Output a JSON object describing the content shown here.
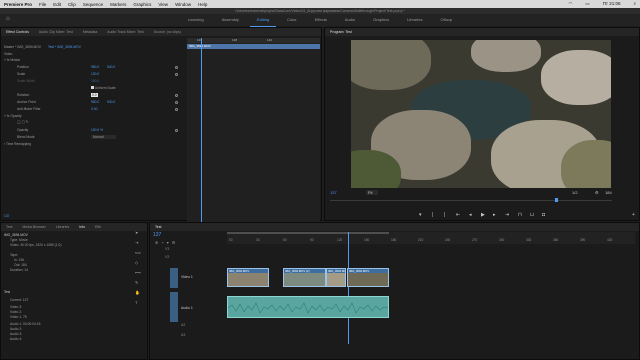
{
  "menubar": {
    "app": "Premiere Pro",
    "items": [
      "File",
      "Edit",
      "Clip",
      "Sequence",
      "Markers",
      "Graphics",
      "View",
      "Window",
      "Help"
    ],
    "clock": "Пт 21:06"
  },
  "title": "/Volumes/external/project/DataCore/Video/04_Агрусова мариамия/Camera/Walkthrough/Project/Test.prproj *",
  "workspaces": [
    "Learning",
    "Assembly",
    "Editing",
    "Color",
    "Effects",
    "Audio",
    "Graphics",
    "Libraries",
    "Обзор"
  ],
  "active_workspace": "Editing",
  "source_tabs": [
    "Effect Controls",
    "Audio Clip Mixer: Test",
    "Metadata",
    "Audio Track Mixer: Test",
    "Source: (no clips)"
  ],
  "effect_controls": {
    "clip_path": "Master * IMG_3694.MOV",
    "seq_path": "Test * IMG_3694.MOV",
    "ruler": [
      "136",
      "138",
      "140"
    ],
    "mini_clip": "IMG_3694.MOV",
    "section_video": "Video",
    "motion": "Motion",
    "position_label": "Position",
    "position_x": "960.0",
    "position_y": "540.0",
    "scale_label": "Scale",
    "scale_value": "100.0",
    "scale_width_label": "Scale Width",
    "scale_width_value": "100.0",
    "uniform_label": "Uniform Scale",
    "rotation_label": "Rotation",
    "rotation_value": "0.0",
    "anchor_label": "Anchor Point",
    "anchor_x": "960.0",
    "anchor_y": "540.0",
    "antiflicker_label": "Anti-flicker Filter",
    "antiflicker_value": "0.00",
    "opacity_section": "Opacity",
    "opacity_label": "Opacity",
    "opacity_value": "100.0 %",
    "blend_label": "Blend Mode",
    "blend_value": "Normal",
    "time_remap": "Time Remapping",
    "timecode": "137"
  },
  "program": {
    "tab": "Program: Test",
    "timecode": "137",
    "fit": "Fit",
    "ratio": "1/2",
    "duration": "184"
  },
  "project_tabs": [
    "Text",
    "Media Browser",
    "Libraries",
    "Info",
    "Effe"
  ],
  "info": {
    "clip": "IMG_3694.MOV",
    "type": "Type: Movie",
    "video": "Video: 30.00 fps, 1920 x 1080 (1.0)",
    "tape": "Tape:",
    "in": "In: 136",
    "out": "Out: 184",
    "duration": "Duration: 14",
    "section": "Test",
    "current": "Current: 137",
    "tracks": [
      "Video 3:",
      "Video 2:",
      "Video 1: 75"
    ],
    "audio": [
      "Audio 1: 00:00:04:18",
      "Audio 2:",
      "Audio 3:",
      "Audio 4:"
    ]
  },
  "timeline": {
    "tab": "Test",
    "timecode": "137",
    "ruler": [
      "00",
      "30",
      "60",
      "90",
      "120",
      "150",
      "180",
      "210",
      "240",
      "270",
      "300",
      "330",
      "360",
      "390",
      "420"
    ],
    "tracks_v": [
      "V3",
      "V2",
      "V1"
    ],
    "tracks_a": [
      "A1",
      "A2",
      "A3"
    ],
    "v1_label": "Video 1",
    "a1_label": "Audio 1",
    "clips": [
      "IMG_3694.MOV",
      "IMG_3693.MOV [V]",
      "IMG_3694.MOV",
      "IMG_3694.MOV"
    ]
  }
}
